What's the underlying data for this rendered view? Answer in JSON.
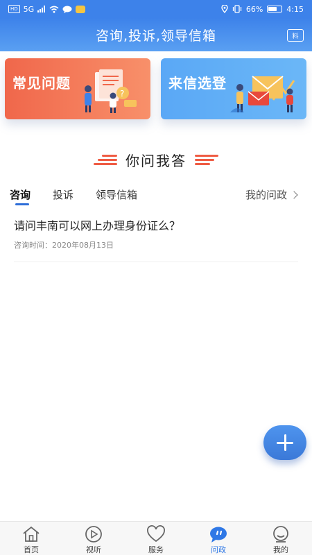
{
  "status_bar": {
    "battery": "66%",
    "time": "4:15",
    "network_badge": "HD",
    "network_type": "5G"
  },
  "header": {
    "title": "咨询,投诉,领导信箱",
    "action_icon": "profile-card-icon",
    "action_label": "料"
  },
  "cards": [
    {
      "label": "常见问题",
      "color": "#f0674b",
      "icon": "faq-illustration"
    },
    {
      "label": "来信选登",
      "color": "#5aa8f6",
      "icon": "letter-illustration"
    }
  ],
  "section": {
    "title": "你问我答",
    "accent": "#ef5c44"
  },
  "tabs": {
    "items": [
      {
        "label": "咨询",
        "active": true
      },
      {
        "label": "投诉",
        "active": false
      },
      {
        "label": "领导信箱",
        "active": false
      }
    ],
    "my_link": "我的问政"
  },
  "questions": [
    {
      "title": "请问丰南可以网上办理身份证么？",
      "time_label": "咨询时间：2020年08月13日"
    }
  ],
  "fab": {
    "icon": "plus-icon",
    "color": "#3b79d8"
  },
  "bottom_nav": {
    "items": [
      {
        "label": "首页",
        "icon": "home-icon",
        "active": false
      },
      {
        "label": "视听",
        "icon": "play-icon",
        "active": false
      },
      {
        "label": "服务",
        "icon": "heart-icon",
        "active": false
      },
      {
        "label": "问政",
        "icon": "chat-icon",
        "active": true
      },
      {
        "label": "我的",
        "icon": "user-icon",
        "active": false
      }
    ],
    "active_color": "#2f78e6"
  }
}
